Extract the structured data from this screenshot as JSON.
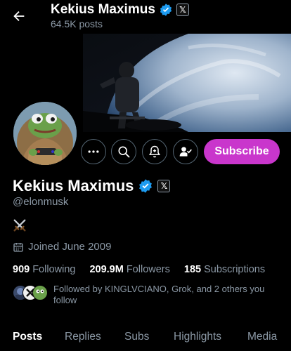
{
  "header": {
    "name": "Kekius Maximus",
    "posts": "64.5K posts"
  },
  "profile": {
    "name": "Kekius Maximus",
    "handle": "@elonmusk",
    "bio_icon": "crossed-swords-icon",
    "joined": "Joined June 2009"
  },
  "actions": {
    "subscribe_label": "Subscribe"
  },
  "stats": {
    "following_count": "909",
    "following_label": "Following",
    "followers_count": "209.9M",
    "followers_label": "Followers",
    "subscriptions_count": "185",
    "subscriptions_label": "Subscriptions"
  },
  "followed_by": "Followed by KINGLVCIANO, Grok, and 2 others you follow",
  "tabs": [
    "Posts",
    "Replies",
    "Subs",
    "Highlights",
    "Media"
  ],
  "badges": {
    "x_badge_text": "𝕏"
  },
  "colors": {
    "accent": "#c936cc",
    "verified": "#1d9bf0",
    "background": "#000000",
    "muted": "#8b98a5"
  }
}
